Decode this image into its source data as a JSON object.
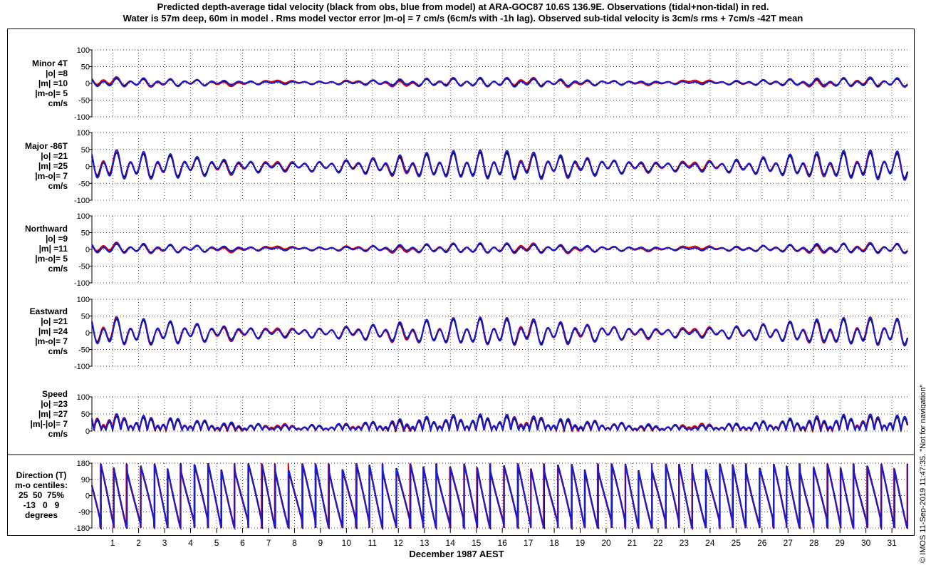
{
  "title_lines": [
    "Predicted depth-average tidal velocity (black from obs, blue from model) at ARA-GOC87 10.6S 136.9E. Observations (tidal+non-tidal) in red.",
    "Water is 57m deep, 60m in model . Rms model vector error |m-o| = 7 cm/s (6cm/s with -1h lag). Observed sub-tidal velocity is 3cm/s rms + 7cm/s -42T mean"
  ],
  "stamp": "© IMOS 11-Sep-2019 11:47:35. \"Not for navigation\"",
  "colors": {
    "observed_tidal": "#000000",
    "model": "#1a1ad8",
    "observed_total": "#e00000",
    "grid": "#000000"
  },
  "chart_data": {
    "type": "line",
    "x_label": "December 1987 AEST",
    "x_ticks": [
      "1",
      "2",
      "3",
      "4",
      "5",
      "6",
      "7",
      "8",
      "9",
      "10",
      "11",
      "12",
      "13",
      "14",
      "15",
      "16",
      "17",
      "18",
      "19",
      "20",
      "21",
      "22",
      "23",
      "24",
      "25",
      "26",
      "27",
      "28",
      "29",
      "30",
      "31"
    ],
    "x_range": [
      0.2,
      31.6
    ],
    "panels": [
      {
        "id": "minor",
        "label_lines": [
          "Minor 4T",
          "|o| =8",
          "|m| =10",
          "|m-o|= 5",
          "cm/s"
        ],
        "ylim": [
          -100,
          100
        ],
        "yticks": [
          "100",
          "50",
          "0",
          "-50",
          "-100"
        ],
        "series_amplitude_cms": {
          "observed_tidal": 8,
          "model": 10
        },
        "summary_stats": {
          "o": 8,
          "m": 10,
          "m_minus_o": 5
        }
      },
      {
        "id": "major",
        "label_lines": [
          "Major -86T",
          "|o| =21",
          "|m| =25",
          "|m-o|= 7",
          "cm/s"
        ],
        "ylim": [
          -100,
          100
        ],
        "yticks": [
          "100",
          "50",
          "0",
          "-50",
          "-100"
        ],
        "series_amplitude_cms": {
          "observed_tidal": 21,
          "model": 25
        },
        "summary_stats": {
          "o": 21,
          "m": 25,
          "m_minus_o": 7
        }
      },
      {
        "id": "northward",
        "label_lines": [
          "Northward",
          "|o| =9",
          "|m| =11",
          "|m-o|= 5",
          "cm/s"
        ],
        "ylim": [
          -100,
          100
        ],
        "yticks": [
          "100",
          "50",
          "0",
          "-50",
          "-100"
        ],
        "series_amplitude_cms": {
          "observed_tidal": 9,
          "model": 11
        },
        "summary_stats": {
          "o": 9,
          "m": 11,
          "m_minus_o": 5
        }
      },
      {
        "id": "eastward",
        "label_lines": [
          "Eastward",
          "|o| =21",
          "|m| =24",
          "|m-o|= 7",
          "cm/s"
        ],
        "ylim": [
          -100,
          100
        ],
        "yticks": [
          "100",
          "50",
          "0",
          "-50",
          "-100"
        ],
        "series_amplitude_cms": {
          "observed_tidal": 21,
          "model": 24
        },
        "summary_stats": {
          "o": 21,
          "m": 24,
          "m_minus_o": 7
        }
      },
      {
        "id": "speed",
        "label_lines": [
          "Speed",
          "|o| =23",
          "|m| =27",
          "|m|-|o|= 7",
          "cm/s"
        ],
        "ylim": [
          0,
          100
        ],
        "yticks": [
          "100",
          "50",
          "0"
        ],
        "series_amplitude_cms": {
          "observed_tidal": 23,
          "model": 27
        },
        "summary_stats": {
          "o": 23,
          "m": 27,
          "m_abs_minus_o_abs": 7
        }
      },
      {
        "id": "direction",
        "label_lines": [
          "Direction (T)",
          "m-o centiles:",
          "25  50  75%",
          "-13   0   9",
          "degrees"
        ],
        "ylim": [
          -180,
          180
        ],
        "yticks": [
          "180",
          "90",
          "0",
          "-90",
          "-180"
        ],
        "centiles_deg": {
          "p25": -13,
          "p50": 0,
          "p75": 9
        }
      }
    ]
  }
}
